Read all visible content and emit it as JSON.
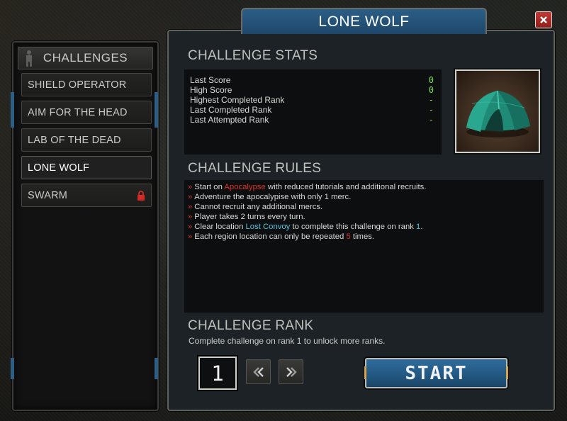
{
  "window": {
    "title": "LONE WOLF"
  },
  "sidebar": {
    "title": "CHALLENGES",
    "items": [
      {
        "label": "SHIELD OPERATOR",
        "locked": false,
        "active": false
      },
      {
        "label": "AIM FOR THE HEAD",
        "locked": false,
        "active": false
      },
      {
        "label": "LAB OF THE DEAD",
        "locked": false,
        "active": false
      },
      {
        "label": "LONE WOLF",
        "locked": false,
        "active": true
      },
      {
        "label": "SWARM",
        "locked": true,
        "active": false
      }
    ]
  },
  "stats": {
    "title": "CHALLENGE STATS",
    "rows": [
      {
        "label": "Last Score",
        "value": "0"
      },
      {
        "label": "High Score",
        "value": "0"
      },
      {
        "label": "Highest Completed Rank",
        "value": "-"
      },
      {
        "label": "Last Completed Rank",
        "value": "-"
      },
      {
        "label": "Last Attempted Rank",
        "value": "-"
      }
    ]
  },
  "rules": {
    "title": "CHALLENGE RULES",
    "lines": [
      {
        "pre": "Start on ",
        "hl": "Apocalypse",
        "hl_color": "red",
        "post": " with reduced tutorials and additional recruits."
      },
      {
        "pre": "Adventure the apocalypise with only 1 merc.",
        "hl": "",
        "hl_color": "",
        "post": ""
      },
      {
        "pre": "Cannot recruit any additional mercs.",
        "hl": "",
        "hl_color": "",
        "post": ""
      },
      {
        "pre": "Player takes 2 turns every turn.",
        "hl": "",
        "hl_color": "",
        "post": ""
      },
      {
        "pre": "Clear location ",
        "hl": "Lost Convoy",
        "hl_color": "cyan",
        "post": " to complete this challenge on rank ",
        "hl2": "1",
        "hl2_color": "cyan",
        "post2": "."
      },
      {
        "pre": "Each region location can only be repeated ",
        "hl": "5",
        "hl_color": "red",
        "post": " times."
      }
    ]
  },
  "rank": {
    "title": "CHALLENGE RANK",
    "note": "Complete challenge on rank 1 to unlock more ranks.",
    "value": "1"
  },
  "start_label": "START",
  "icons": {
    "close": "close-icon",
    "prev": "double-chevron-left-icon",
    "next": "double-chevron-right-icon",
    "lock": "lock-icon",
    "tent": "tent-icon"
  },
  "colors": {
    "accent_blue": "#2b5e86",
    "stat_value": "#7ee04a",
    "highlight_red": "#e0302a",
    "highlight_cyan": "#4fc6df",
    "lock_red": "#d42a27"
  }
}
